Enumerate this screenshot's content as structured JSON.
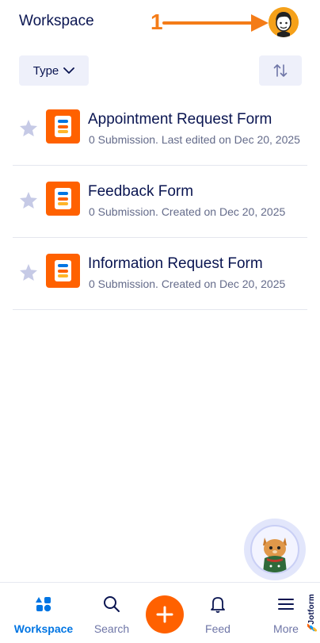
{
  "header": {
    "title": "Workspace",
    "annotation_number": "1"
  },
  "toolbar": {
    "type_label": "Type"
  },
  "forms": [
    {
      "name": "Appointment Request Form",
      "meta": "0 Submission. Last edited on Dec 20, 2025"
    },
    {
      "name": "Feedback Form",
      "meta": "0 Submission. Created on Dec 20, 2025"
    },
    {
      "name": "Information Request Form",
      "meta": "0 Submission. Created on Dec 20, 2025"
    }
  ],
  "bottom_nav": {
    "workspace": "Workspace",
    "search": "Search",
    "feed": "Feed",
    "more": "More"
  },
  "brand": {
    "name": "Jotform"
  },
  "colors": {
    "primary_text": "#0a1551",
    "accent_orange": "#ff6100",
    "active_blue": "#0075e3",
    "muted": "#646b8a",
    "button_bg": "#eef0fa"
  },
  "icons": {
    "star": "star-icon",
    "form": "form-icon",
    "sort": "sort-icon",
    "chevron": "chevron-down-icon",
    "workspace": "workspace-icon",
    "search": "search-icon",
    "plus": "plus-icon",
    "feed": "bell-icon",
    "more": "menu-icon"
  }
}
